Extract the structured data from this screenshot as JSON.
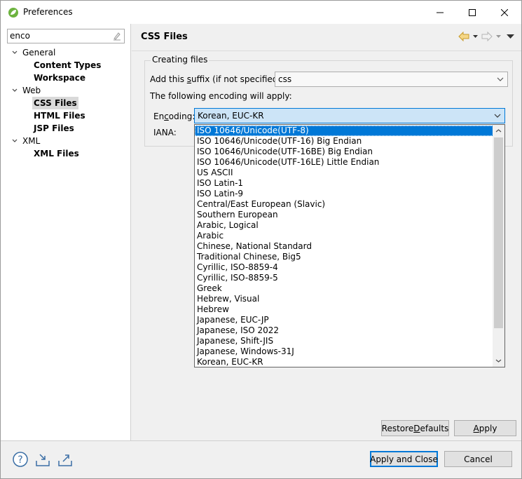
{
  "window": {
    "title": "Preferences",
    "controls": {
      "minimize": "—",
      "maximize": "☐",
      "close": "✕"
    }
  },
  "filter": {
    "value": "enco"
  },
  "tree": [
    {
      "label": "General",
      "expanded": true,
      "level": 0
    },
    {
      "label": "Content Types",
      "level": 1
    },
    {
      "label": "Workspace",
      "level": 1
    },
    {
      "label": "Web",
      "expanded": true,
      "level": 0
    },
    {
      "label": "CSS Files",
      "level": 1,
      "selected": true
    },
    {
      "label": "HTML Files",
      "level": 1
    },
    {
      "label": "JSP Files",
      "level": 1
    },
    {
      "label": "XML",
      "expanded": true,
      "level": 0
    },
    {
      "label": "XML Files",
      "level": 1
    }
  ],
  "page": {
    "title": "CSS Files",
    "group_title": "Creating files",
    "suffix_label_pre": "Add this ",
    "suffix_label_u": "s",
    "suffix_label_post": "uffix (if not specified):",
    "suffix_value": "css",
    "encoding_note": "The following encoding will apply:",
    "encoding_label_pre": "En",
    "encoding_label_u": "c",
    "encoding_label_post": "oding:",
    "encoding_value": "Korean, EUC-KR",
    "iana_label": "IANA:"
  },
  "encoding_options": [
    "ISO 10646/Unicode(UTF-8)",
    "ISO 10646/Unicode(UTF-16) Big Endian",
    "ISO 10646/Unicode(UTF-16BE) Big Endian",
    "ISO 10646/Unicode(UTF-16LE) Little Endian",
    "US ASCII",
    "ISO Latin-1",
    "ISO Latin-9",
    "Central/East European (Slavic)",
    "Southern European",
    "Arabic, Logical",
    "Arabic",
    "Chinese, National Standard",
    "Traditional Chinese, Big5",
    "Cyrillic, ISO-8859-4",
    "Cyrillic, ISO-8859-5",
    "Greek",
    "Hebrew, Visual",
    "Hebrew",
    "Japanese, EUC-JP",
    "Japanese, ISO 2022",
    "Japanese, Shift-JIS",
    "Japanese, Windows-31J",
    "Korean, EUC-KR"
  ],
  "highlighted_option_index": 0,
  "buttons": {
    "restore_defaults_pre": "Restore ",
    "restore_defaults_u": "D",
    "restore_defaults_post": "efaults",
    "apply_pre": "",
    "apply_u": "A",
    "apply_post": "pply",
    "apply_and_close": "Apply and Close",
    "cancel": "Cancel"
  },
  "colors": {
    "accent": "#0078d7",
    "selection": "#0078d7",
    "help_icon": "#3a6ea5"
  }
}
